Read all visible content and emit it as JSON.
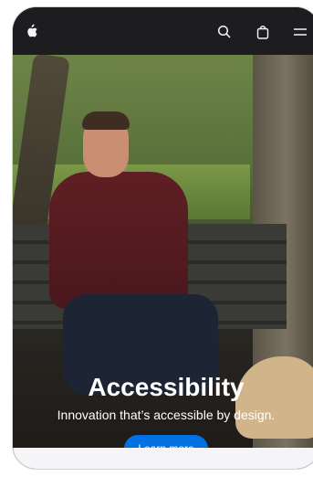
{
  "hero": {
    "title": "Accessibility",
    "subtitle": "Innovation that’s accessible by design.",
    "cta_label": "Learn more"
  },
  "colors": {
    "nav_bg": "#1d1d1f",
    "accent": "#0071e3",
    "footer_bg": "#f5f5f7"
  },
  "icons": {
    "apple": "apple-logo",
    "search": "search-icon",
    "bag": "shopping-bag-icon",
    "menu": "menu-icon"
  }
}
